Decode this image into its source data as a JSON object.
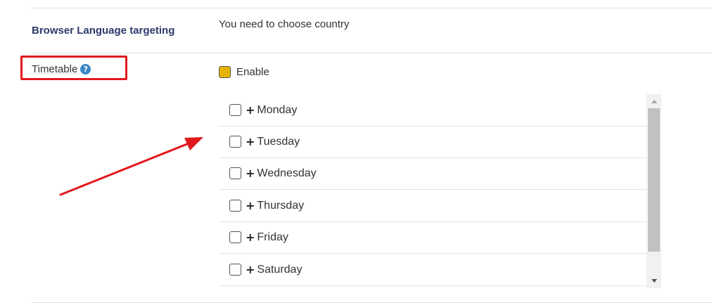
{
  "browser_language": {
    "label": "Browser Language targeting",
    "message": "You need to choose country"
  },
  "timetable": {
    "label": "Timetable",
    "help_icon": "question-circle-icon",
    "enable_label": "Enable",
    "enable_checked": true,
    "days": [
      {
        "label": "Monday",
        "checked": false
      },
      {
        "label": "Tuesday",
        "checked": false
      },
      {
        "label": "Wednesday",
        "checked": false
      },
      {
        "label": "Thursday",
        "checked": false
      },
      {
        "label": "Friday",
        "checked": false
      },
      {
        "label": "Saturday",
        "checked": false
      }
    ],
    "expand_symbol": "+"
  },
  "colors": {
    "label_accent": "#2d3a6b",
    "enable_checked": "#e6b400",
    "annotation_red": "#e0191e",
    "help_icon_blue": "#3a86c4"
  }
}
